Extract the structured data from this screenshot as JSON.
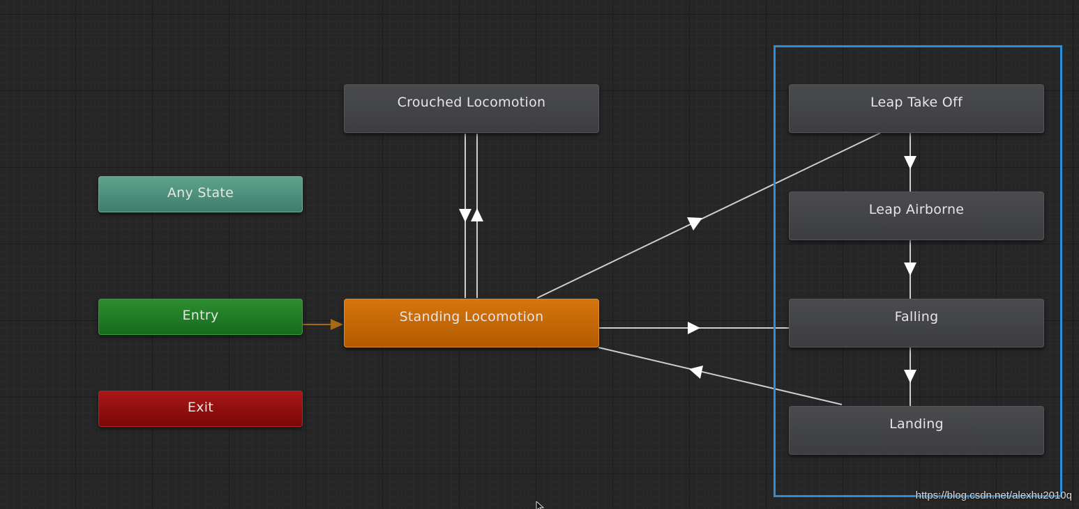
{
  "graph": {
    "states": {
      "any_state": "Any State",
      "entry": "Entry",
      "exit": "Exit",
      "crouched_locomotion": "Crouched Locomotion",
      "standing_locomotion": "Standing Locomotion",
      "leap_take_off": "Leap Take Off",
      "leap_airborne": "Leap Airborne",
      "falling": "Falling",
      "landing": "Landing"
    },
    "default_state": "Standing Locomotion"
  },
  "colors": {
    "any_state": "#4f937e",
    "entry": "#1f7b24",
    "exit": "#920f0f",
    "default_state": "#c96a06",
    "state": "#434447",
    "selection": "#2a8fd8",
    "transition": "#cfcfcf",
    "entry_transition": "#a56a16"
  },
  "watermark": "https://blog.csdn.net/alexhu2010q",
  "cursor_icon": "mouse-pointer-icon"
}
